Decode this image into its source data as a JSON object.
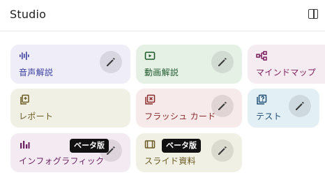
{
  "header": {
    "title": "Studio",
    "panel_icon": "side-panel-icon"
  },
  "cards": [
    {
      "id": "audio",
      "label": "音声解説",
      "icon": "audio-waveform-icon",
      "bg": "#eeedf8",
      "accent": "#3b3f9e",
      "edit": true
    },
    {
      "id": "video",
      "label": "動画解説",
      "icon": "video-play-icon",
      "bg": "#e6f1e6",
      "accent": "#1f5b2c",
      "edit": true
    },
    {
      "id": "mindmap",
      "label": "マインドマップ",
      "icon": "mind-map-icon",
      "bg": "#f5ecf1",
      "accent": "#7b1c5c",
      "edit": false
    },
    {
      "id": "report",
      "label": "レポート",
      "icon": "report-icon",
      "bg": "#f1f0e4",
      "accent": "#6b5a22",
      "edit": false
    },
    {
      "id": "flashcard",
      "label": "フラッシュ カード",
      "icon": "flashcard-icon",
      "bg": "#f7eaea",
      "accent": "#8a2a2a",
      "edit": true
    },
    {
      "id": "test",
      "label": "テスト",
      "icon": "quiz-icon",
      "bg": "#e2eff5",
      "accent": "#1f4e73",
      "edit": true
    },
    {
      "id": "infographic",
      "label": "インフォグラフィック",
      "icon": "bar-chart-icon",
      "bg": "#f3eaf2",
      "accent": "#6b1f61",
      "edit": true,
      "badge": "ベータ版"
    },
    {
      "id": "slides",
      "label": "スライド資料",
      "icon": "slides-icon",
      "bg": "#f1f0e4",
      "accent": "#6b5a22",
      "edit": true,
      "badge": "ベータ版"
    }
  ]
}
